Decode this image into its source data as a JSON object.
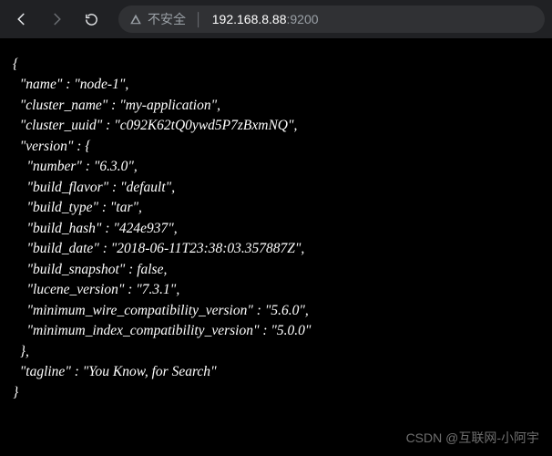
{
  "toolbar": {
    "insecure_label": "不安全",
    "host": "192.168.8.88",
    "port": ":9200"
  },
  "response": {
    "name": "node-1",
    "cluster_name": "my-application",
    "cluster_uuid": "c092K62tQ0ywd5P7zBxmNQ",
    "version": {
      "number": "6.3.0",
      "build_flavor": "default",
      "build_type": "tar",
      "build_hash": "424e937",
      "build_date": "2018-06-11T23:38:03.357887Z",
      "build_snapshot": false,
      "lucene_version": "7.3.1",
      "minimum_wire_compatibility_version": "5.6.0",
      "minimum_index_compatibility_version": "5.0.0"
    },
    "tagline": "You Know, for Search"
  },
  "labels": {
    "name": "name",
    "cluster_name": "cluster_name",
    "cluster_uuid": "cluster_uuid",
    "version": "version",
    "number": "number",
    "build_flavor": "build_flavor",
    "build_type": "build_type",
    "build_hash": "build_hash",
    "build_date": "build_date",
    "build_snapshot": "build_snapshot",
    "lucene_version": "lucene_version",
    "min_wire": "minimum_wire_compatibility_version",
    "min_index": "minimum_index_compatibility_version",
    "tagline": "tagline"
  },
  "watermark": "CSDN @互联网-小阿宇"
}
